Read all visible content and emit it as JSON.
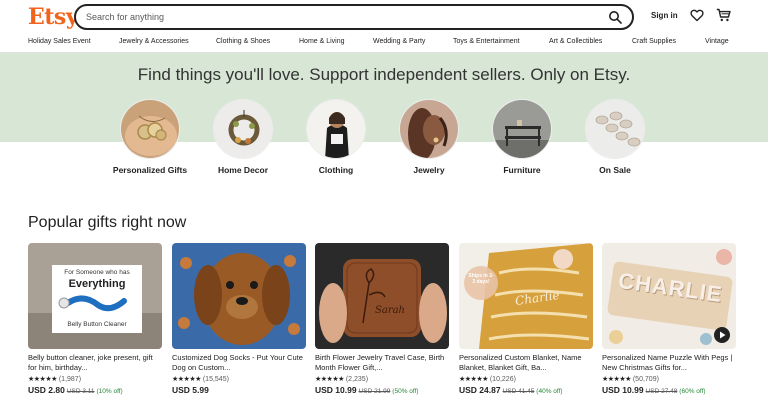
{
  "header": {
    "logo": "Etsy",
    "search_placeholder": "Search for anything",
    "signin_label": "Sign in"
  },
  "categories": [
    "Holiday Sales Event",
    "Jewelry & Accessories",
    "Clothing & Shoes",
    "Home & Living",
    "Wedding & Party",
    "Toys & Entertainment",
    "Art & Collectibles",
    "Craft Supplies",
    "Vintage"
  ],
  "hero": {
    "title": "Find things you'll love. Support independent sellers. Only on Etsy."
  },
  "circles": [
    {
      "label": "Personalized Gifts"
    },
    {
      "label": "Home Decor"
    },
    {
      "label": "Clothing"
    },
    {
      "label": "Jewelry"
    },
    {
      "label": "Furniture"
    },
    {
      "label": "On Sale"
    }
  ],
  "section": {
    "title": "Popular gifts right now"
  },
  "products": [
    {
      "title": "Belly button cleaner, joke present, gift for him, birthday...",
      "stars": "★★★★★",
      "reviews": "(1,987)",
      "price": "USD 2.80",
      "was": "USD 3.11",
      "off": "(10% off)",
      "thumb_text_top": "For Someone who has",
      "thumb_text_big": "Everything",
      "thumb_text_bottom": "Belly Button Cleaner"
    },
    {
      "title": "Customized Dog Socks - Put Your Cute Dog on Custom...",
      "stars": "★★★★★",
      "reviews": "(15,545)",
      "price": "USD 5.99",
      "was": "",
      "off": ""
    },
    {
      "title": "Birth Flower Jewelry Travel Case, Birth Month Flower Gift,...",
      "stars": "★★★★★",
      "reviews": "(2,235)",
      "price": "USD 10.99",
      "was": "USD 21.99",
      "off": "(50% off)",
      "thumb_text_name": "Sarah"
    },
    {
      "title": "Personalized Custom Blanket, Name Blanket, Blanket Gift, Ba...",
      "stars": "★★★★★",
      "reviews": "(10,226)",
      "price": "USD 24.87",
      "was": "USD 41.45",
      "off": "(40% off)",
      "thumb_badge": "Ships in 2-3 days!",
      "thumb_text_name": "Charlie"
    },
    {
      "title": "Personalized Name Puzzle With Pegs | New Christmas Gifts for...",
      "stars": "★★★★★",
      "reviews": "(50,709)",
      "price": "USD 10.99",
      "was": "USD 27.48",
      "off": "(60% off)",
      "thumb_text_name": "CHARLIE"
    }
  ],
  "colors": {
    "brand": "#f1641e",
    "hero_bg": "#d7e6d5",
    "sale_green": "#258635"
  }
}
